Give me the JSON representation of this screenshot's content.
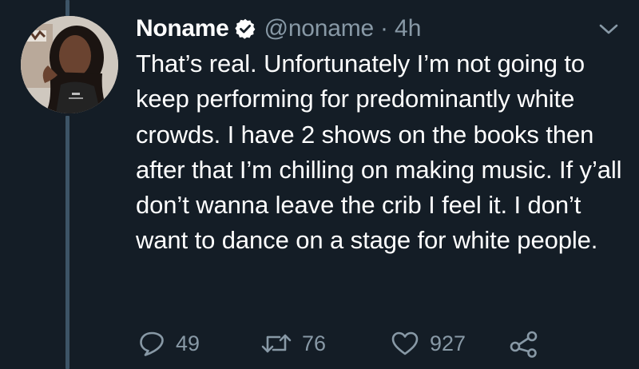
{
  "tweet": {
    "display_name": "Noname",
    "handle": "@noname",
    "separator": "·",
    "time": "4h",
    "text": "That’s real. Unfortunately I’m not going to keep performing for predominantly white crowds. I have 2 shows on the books then after that I’m chilling on making music. If y’all don’t wanna leave the crib I feel it. I don’t want to dance on a stage for white people.",
    "verified": true
  },
  "actions": {
    "reply_count": "49",
    "retweet_count": "76",
    "like_count": "927"
  },
  "icons": {
    "verified": "verified-badge-icon",
    "menu": "chevron-down-icon",
    "reply": "reply-bubble-icon",
    "retweet": "retweet-arrows-icon",
    "like": "heart-icon",
    "share": "share-nodes-icon"
  },
  "colors": {
    "background": "#141d26",
    "text_primary": "#ffffff",
    "text_secondary": "#8899a6",
    "thread_line": "#3d5466"
  }
}
